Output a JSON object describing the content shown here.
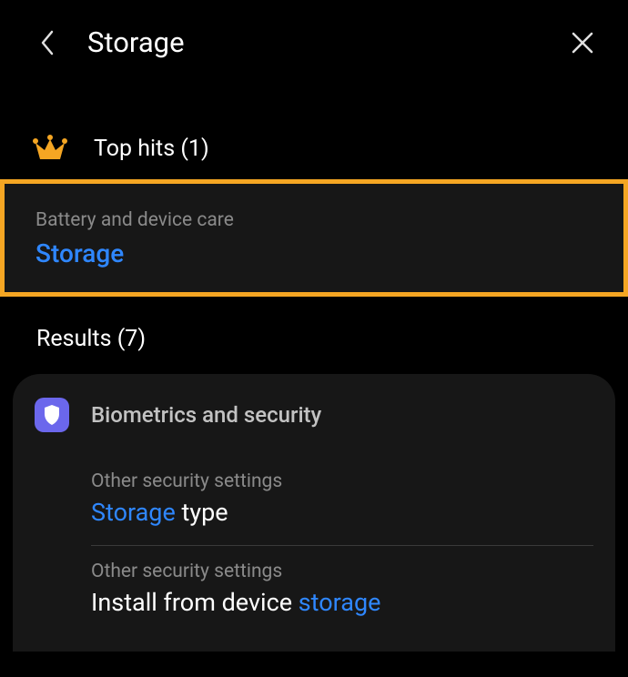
{
  "header": {
    "title": "Storage"
  },
  "top_hits": {
    "label_prefix": "Top hits",
    "count": 1,
    "items": [
      {
        "breadcrumb": "Battery and device care",
        "title_parts": [
          {
            "text": "Storage",
            "highlight": true
          }
        ]
      }
    ]
  },
  "results": {
    "label_prefix": "Results",
    "count": 7,
    "group_title": "Biometrics and security",
    "items": [
      {
        "breadcrumb": "Other security settings",
        "title_parts": [
          {
            "text": "Storage",
            "highlight": true
          },
          {
            "text": " type",
            "highlight": false
          }
        ]
      },
      {
        "breadcrumb": "Other security settings",
        "title_parts": [
          {
            "text": "Install from device ",
            "highlight": false
          },
          {
            "text": "storage",
            "highlight": true
          }
        ]
      }
    ]
  }
}
